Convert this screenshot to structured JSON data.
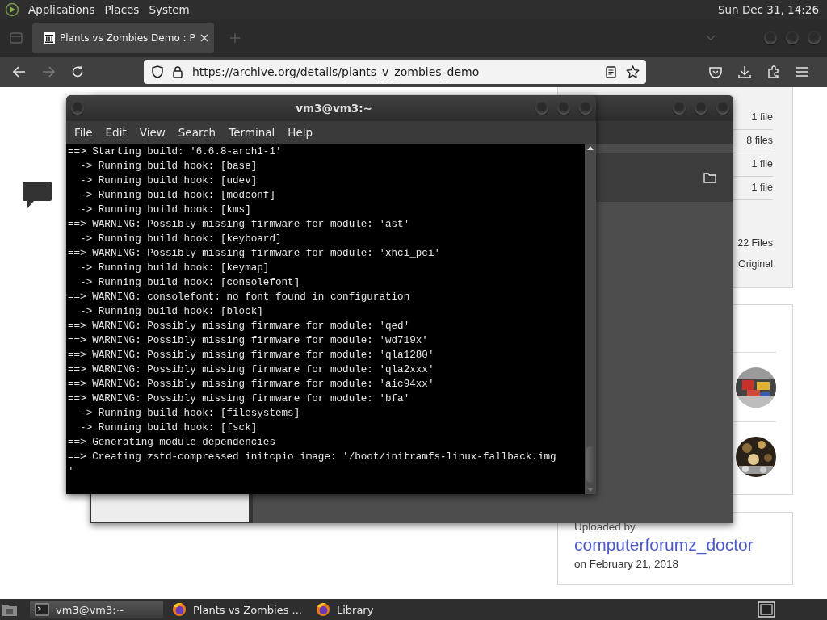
{
  "top_panel": {
    "menus": [
      "Applications",
      "Places",
      "System"
    ],
    "clock": "Sun Dec 31, 14:26"
  },
  "browser": {
    "tabs": [
      {
        "title": "Plants vs Zombies Demo : P",
        "selected": true
      }
    ],
    "forward_disabled": true,
    "url": "https://archive.org/details/plants_v_zombies_demo",
    "file_counts": [
      "1 file",
      "8 files",
      "1 file",
      "1 file"
    ],
    "summary": [
      "22 Files",
      "Original"
    ],
    "uploader": {
      "label": "Uploaded by",
      "name": "computerforumz_doctor",
      "date": "on February 21, 2018"
    }
  },
  "terminal": {
    "title": "vm3@vm3:~",
    "menus": [
      "File",
      "Edit",
      "View",
      "Search",
      "Terminal",
      "Help"
    ],
    "lines": [
      "==> Starting build: '6.6.8-arch1-1'",
      "  -> Running build hook: [base]",
      "  -> Running build hook: [udev]",
      "  -> Running build hook: [modconf]",
      "  -> Running build hook: [kms]",
      "==> WARNING: Possibly missing firmware for module: 'ast'",
      "  -> Running build hook: [keyboard]",
      "==> WARNING: Possibly missing firmware for module: 'xhci_pci'",
      "  -> Running build hook: [keymap]",
      "  -> Running build hook: [consolefont]",
      "==> WARNING: consolefont: no font found in configuration",
      "  -> Running build hook: [block]",
      "==> WARNING: Possibly missing firmware for module: 'qed'",
      "==> WARNING: Possibly missing firmware for module: 'wd719x'",
      "==> WARNING: Possibly missing firmware for module: 'qla1280'",
      "==> WARNING: Possibly missing firmware for module: 'qla2xxx'",
      "==> WARNING: Possibly missing firmware for module: 'aic94xx'",
      "==> WARNING: Possibly missing firmware for module: 'bfa'",
      "  -> Running build hook: [filesystems]",
      "  -> Running build hook: [fsck]",
      "==> Generating module dependencies",
      "==> Creating zstd-compressed initcpio image: '/boot/initramfs-linux-fallback.img",
      "'"
    ]
  },
  "taskbar": {
    "items": [
      {
        "label": "vm3@vm3:~",
        "kind": "terminal",
        "selected": true
      },
      {
        "label": "Plants vs Zombies ...",
        "kind": "browser",
        "selected": false
      },
      {
        "label": "Library",
        "kind": "browser",
        "selected": false
      }
    ]
  }
}
